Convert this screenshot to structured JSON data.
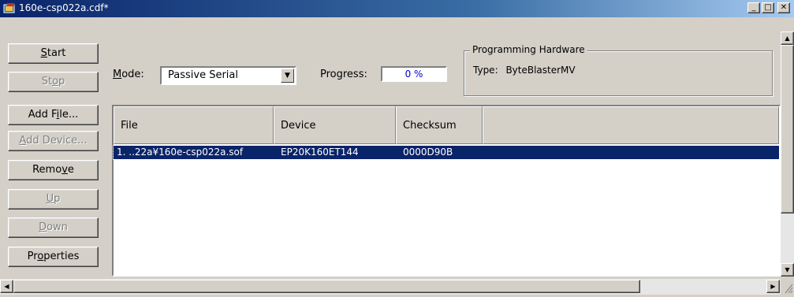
{
  "window": {
    "title": "160e-csp022a.cdf*",
    "controls": {
      "minimize": "_",
      "maximize": "□",
      "close": "✕"
    }
  },
  "buttons": {
    "start": {
      "pre": "",
      "key": "S",
      "post": "tart"
    },
    "stop": {
      "pre": "St",
      "key": "o",
      "post": "p"
    },
    "add_file": {
      "pre": "Add F",
      "key": "i",
      "post": "le..."
    },
    "add_device": {
      "pre": "",
      "key": "A",
      "post": "dd Device..."
    },
    "remove": {
      "pre": "Remo",
      "key": "v",
      "post": "e"
    },
    "up": {
      "pre": "",
      "key": "U",
      "post": "p"
    },
    "down": {
      "pre": "",
      "key": "D",
      "post": "own"
    },
    "properties": {
      "pre": "Pr",
      "key": "o",
      "post": "perties"
    }
  },
  "mode": {
    "label_key": "M",
    "label_rest": "ode:",
    "value": "Passive Serial"
  },
  "progress": {
    "label": "Progress:",
    "value": "0 %"
  },
  "hardware": {
    "group_title": "Programming Hardware",
    "type_label": "Type:",
    "type_value": "ByteBlasterMV"
  },
  "table": {
    "columns": [
      "File",
      "Device",
      "Checksum"
    ],
    "rows": [
      {
        "file": "1. ..22a¥160e-csp022a.sof",
        "device": "EP20K160ET144",
        "checksum": "0000D90B"
      }
    ]
  }
}
